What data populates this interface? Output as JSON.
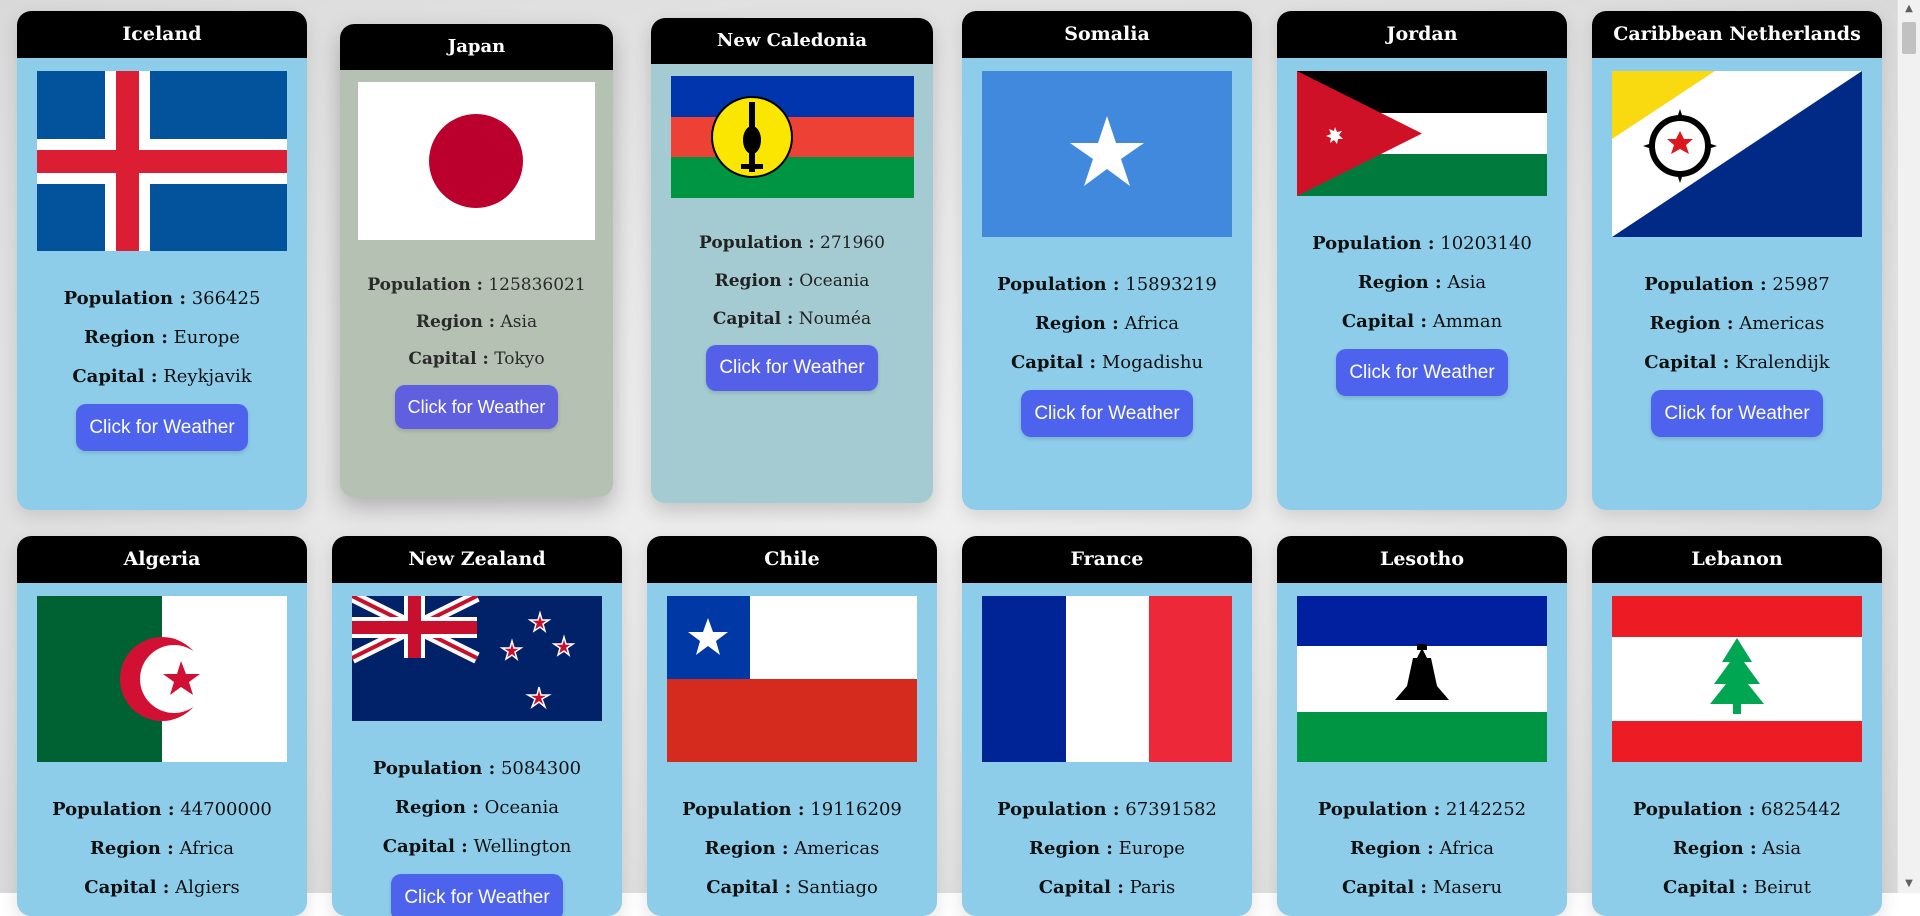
{
  "labels": {
    "population": "Population :",
    "region": "Region :",
    "capital": "Capital :",
    "button": "Click for Weather"
  },
  "cards": [
    {
      "name": "Iceland",
      "population": "366425",
      "region": "Europe",
      "capital": "Reykjavik",
      "flag": "iceland"
    },
    {
      "name": "Japan",
      "population": "125836021",
      "region": "Asia",
      "capital": "Tokyo",
      "flag": "japan"
    },
    {
      "name": "New Caledonia",
      "population": "271960",
      "region": "Oceania",
      "capital": "Nouméa",
      "flag": "new-caledonia"
    },
    {
      "name": "Somalia",
      "population": "15893219",
      "region": "Africa",
      "capital": "Mogadishu",
      "flag": "somalia"
    },
    {
      "name": "Jordan",
      "population": "10203140",
      "region": "Asia",
      "capital": "Amman",
      "flag": "jordan"
    },
    {
      "name": "Caribbean Netherlands",
      "population": "25987",
      "region": "Americas",
      "capital": "Kralendijk",
      "flag": "caribbean-netherlands"
    },
    {
      "name": "Algeria",
      "population": "44700000",
      "region": "Africa",
      "capital": "Algiers",
      "flag": "algeria"
    },
    {
      "name": "New Zealand",
      "population": "5084300",
      "region": "Oceania",
      "capital": "Wellington",
      "flag": "new-zealand"
    },
    {
      "name": "Chile",
      "population": "19116209",
      "region": "Americas",
      "capital": "Santiago",
      "flag": "chile"
    },
    {
      "name": "France",
      "population": "67391582",
      "region": "Europe",
      "capital": "Paris",
      "flag": "france"
    },
    {
      "name": "Lesotho",
      "population": "2142252",
      "region": "Africa",
      "capital": "Maseru",
      "flag": "lesotho"
    },
    {
      "name": "Lebanon",
      "population": "6825442",
      "region": "Asia",
      "capital": "Beirut",
      "flag": "lebanon"
    }
  ],
  "colors": {
    "card": "#8ecdea",
    "header": "#000000",
    "button": "#4d63ee"
  }
}
